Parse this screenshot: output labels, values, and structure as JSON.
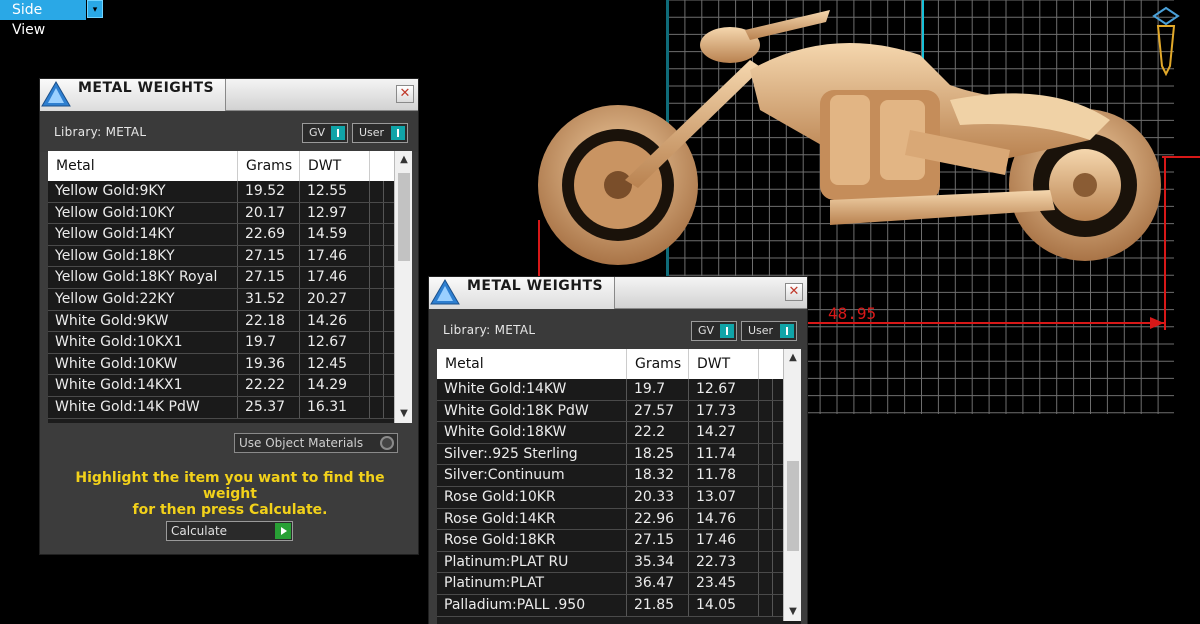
{
  "view_menu": {
    "label": "Side View",
    "caret": "▾"
  },
  "viewport": {
    "dimension_label": "48.95",
    "colors": {
      "grid": "#7a7a7a",
      "dimension": "#d81818",
      "axis": "#16c0d8",
      "model": "#e0b488"
    }
  },
  "dialog_left": {
    "title": "METAL WEIGHTS",
    "close": "✕",
    "library_label": "Library: METAL",
    "gv_label": "GV",
    "user_label": "User",
    "columns": {
      "metal": "Metal",
      "grams": "Grams",
      "dwt": "DWT"
    },
    "rows": [
      {
        "metal": "Yellow Gold:9KY",
        "grams": "19.52",
        "dwt": "12.55"
      },
      {
        "metal": "Yellow Gold:10KY",
        "grams": "20.17",
        "dwt": "12.97"
      },
      {
        "metal": "Yellow Gold:14KY",
        "grams": "22.69",
        "dwt": "14.59"
      },
      {
        "metal": "Yellow Gold:18KY",
        "grams": "27.15",
        "dwt": "17.46"
      },
      {
        "metal": "Yellow Gold:18KY Royal",
        "grams": "27.15",
        "dwt": "17.46"
      },
      {
        "metal": "Yellow Gold:22KY",
        "grams": "31.52",
        "dwt": "20.27"
      },
      {
        "metal": "White Gold:9KW",
        "grams": "22.18",
        "dwt": "14.26"
      },
      {
        "metal": "White Gold:10KX1",
        "grams": "19.7",
        "dwt": "12.67"
      },
      {
        "metal": "White Gold:10KW",
        "grams": "19.36",
        "dwt": "12.45"
      },
      {
        "metal": "White Gold:14KX1",
        "grams": "22.22",
        "dwt": "14.29"
      },
      {
        "metal": "White Gold:14K PdW",
        "grams": "25.37",
        "dwt": "16.31"
      }
    ],
    "use_object_materials": "Use Object Materials",
    "hint_line1": "Highlight the item you want to find the weight",
    "hint_line2": "for then press Calculate.",
    "calculate_label": "Calculate",
    "scroll_up": "▲",
    "scroll_down": "▼"
  },
  "dialog_right": {
    "title": "METAL WEIGHTS",
    "close": "✕",
    "library_label": "Library: METAL",
    "gv_label": "GV",
    "user_label": "User",
    "columns": {
      "metal": "Metal",
      "grams": "Grams",
      "dwt": "DWT"
    },
    "rows": [
      {
        "metal": "White Gold:14KW",
        "grams": "19.7",
        "dwt": "12.67"
      },
      {
        "metal": "White Gold:18K PdW",
        "grams": "27.57",
        "dwt": "17.73"
      },
      {
        "metal": "White Gold:18KW",
        "grams": "22.2",
        "dwt": "14.27"
      },
      {
        "metal": "Silver:.925 Sterling",
        "grams": "18.25",
        "dwt": "11.74"
      },
      {
        "metal": "Silver:Continuum",
        "grams": "18.32",
        "dwt": "11.78"
      },
      {
        "metal": "Rose Gold:10KR",
        "grams": "20.33",
        "dwt": "13.07"
      },
      {
        "metal": "Rose Gold:14KR",
        "grams": "22.96",
        "dwt": "14.76"
      },
      {
        "metal": "Rose Gold:18KR",
        "grams": "27.15",
        "dwt": "17.46"
      },
      {
        "metal": "Platinum:PLAT RU",
        "grams": "35.34",
        "dwt": "22.73"
      },
      {
        "metal": "Platinum:PLAT",
        "grams": "36.47",
        "dwt": "23.45"
      },
      {
        "metal": "Palladium:PALL .950",
        "grams": "21.85",
        "dwt": "14.05"
      }
    ],
    "scroll_up": "▲",
    "scroll_down": "▼"
  }
}
